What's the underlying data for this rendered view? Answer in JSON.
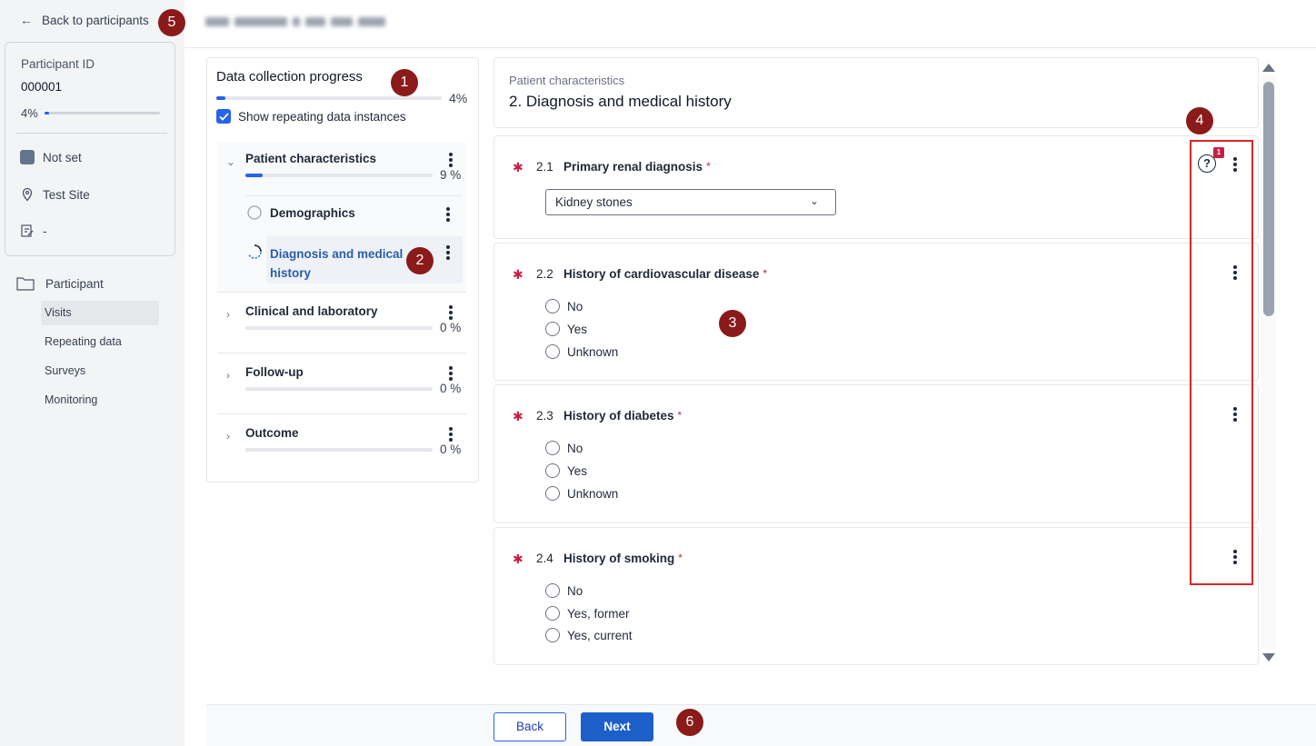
{
  "sidebar": {
    "back_label": "Back to participants",
    "participant_id_label": "Participant ID",
    "participant_id": "000001",
    "progress_pct": "4%",
    "progress_fraction": 0.04,
    "status": "Not set",
    "site": "Test Site",
    "note": "-",
    "nav_root": "Participant",
    "nav_items": [
      {
        "label": "Visits"
      },
      {
        "label": "Repeating data"
      },
      {
        "label": "Surveys"
      },
      {
        "label": "Monitoring"
      }
    ]
  },
  "progress_panel": {
    "title": "Data collection progress",
    "pct": "4%",
    "fraction": 0.04,
    "show_repeating_label": "Show repeating data instances",
    "sections": [
      {
        "name": "Patient characteristics",
        "pct": "9 %",
        "fraction": 0.09,
        "subsections": [
          {
            "name": "Demographics"
          },
          {
            "name": "Diagnosis and medical",
            "name_line2": "history"
          }
        ]
      },
      {
        "name": "Clinical and laboratory",
        "pct": "0 %",
        "fraction": 0
      },
      {
        "name": "Follow-up",
        "pct": "0 %",
        "fraction": 0
      },
      {
        "name": "Outcome",
        "pct": "0 %",
        "fraction": 0
      }
    ]
  },
  "form": {
    "breadcrumb": "Patient characteristics",
    "title": "2. Diagnosis and medical history",
    "query_count": "1",
    "questions": [
      {
        "num": "2.1",
        "label": "Primary renal diagnosis",
        "select_value": "Kidney stones"
      },
      {
        "num": "2.2",
        "label": "History of cardiovascular disease",
        "options": [
          "No",
          "Yes",
          "Unknown"
        ]
      },
      {
        "num": "2.3",
        "label": "History of diabetes",
        "options": [
          "No",
          "Yes",
          "Unknown"
        ]
      },
      {
        "num": "2.4",
        "label": "History of smoking",
        "options": [
          "No",
          "Yes, former",
          "Yes, current"
        ]
      }
    ]
  },
  "footer": {
    "back_label": "Back",
    "next_label": "Next"
  },
  "markers": [
    "1",
    "2",
    "3",
    "4",
    "5",
    "6"
  ],
  "colors": {
    "accent": "#2563eb",
    "required": "#c81e44",
    "marker": "#8b1a1a",
    "highlight": "#dc2626"
  }
}
